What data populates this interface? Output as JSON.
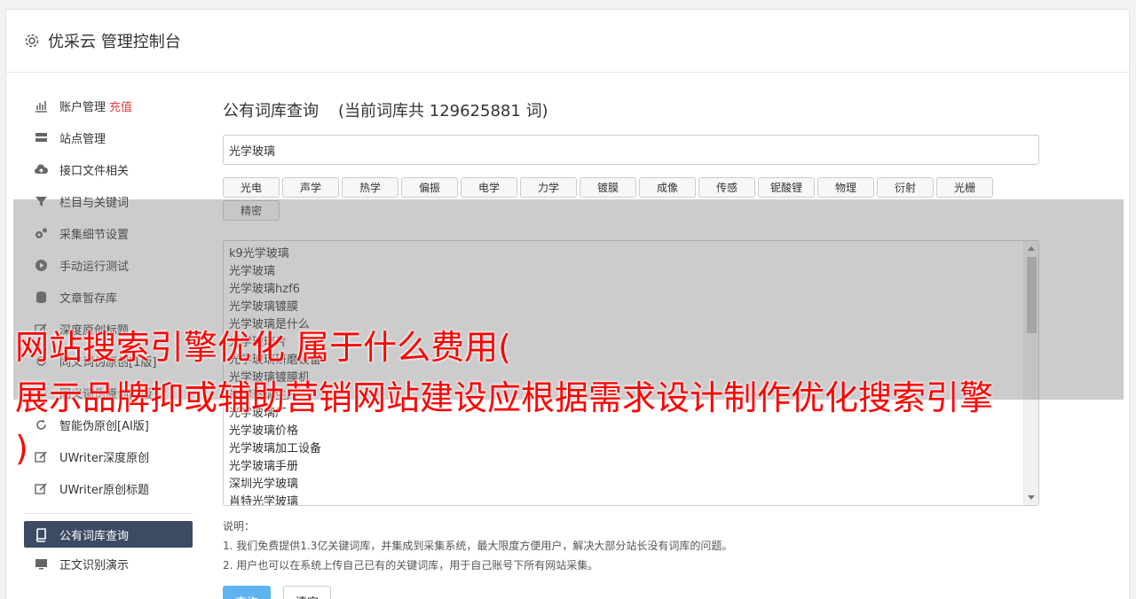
{
  "header": {
    "title": "优采云 管理控制台"
  },
  "sidebar": {
    "items": [
      {
        "label": "账户管理",
        "badge": "充值"
      },
      {
        "label": "站点管理"
      },
      {
        "label": "接口文件相关"
      },
      {
        "label": "栏目与关键词"
      },
      {
        "label": "采集细节设置"
      },
      {
        "label": "手动运行测试"
      },
      {
        "label": "文章暂存库"
      },
      {
        "label": "深度原创标题"
      },
      {
        "label": "同义词伪原创[1版]"
      },
      {
        "label": "同义词伪原创[2版]"
      },
      {
        "label": "智能伪原创[AI版]"
      },
      {
        "label": "UWriter深度原创"
      },
      {
        "label": "UWriter原创标题"
      }
    ],
    "active_item": {
      "label": "公有词库查询"
    },
    "after_items": [
      {
        "label": "正文识别演示"
      }
    ]
  },
  "main": {
    "title": "公有词库查询",
    "count_text": "(当前词库共 129625881 词)",
    "search_value": "光学玻璃",
    "tags": [
      "光电",
      "声学",
      "热学",
      "偏振",
      "电学",
      "力学",
      "镀膜",
      "成像",
      "传感",
      "铌酸锂",
      "物理",
      "衍射",
      "光栅",
      "精密"
    ],
    "results": [
      "k9光学玻璃",
      "光学玻璃",
      "光学玻璃hzf6",
      "光学玻璃镀膜",
      "光学玻璃是什么",
      "光学玻璃片",
      "光学玻璃研磨设备",
      "光学玻璃镀膜机",
      "光学玻璃生产",
      "光学玻璃厂",
      "光学玻璃价格",
      "光学玻璃加工设备",
      "光学玻璃手册",
      "深圳光学玻璃",
      "肖特光学玻璃"
    ],
    "notes": {
      "heading": "说明：",
      "line1": "1. 我们免费提供1.3亿关键词库，并集成到采集系统，最大限度方便用户，解决大部分站长没有词库的问题。",
      "line2": "2. 用户也可以在系统上传自己已有的关键词库，用于自己账号下所有网站采集。"
    },
    "query_button": "查询",
    "clear_button": "清空"
  },
  "overlay": {
    "line1": "网站搜索引擎优化 属于什么费用(",
    "line2": "展示品牌抑或辅助营销网站建设应根据需求设计制作优化搜索引擎",
    "line3": ")"
  },
  "colors": {
    "sidebar_active": "#3c4a63",
    "primary_button": "#5fb4f0",
    "badge": "#e4393c",
    "overlay_text": "#ff0000"
  }
}
